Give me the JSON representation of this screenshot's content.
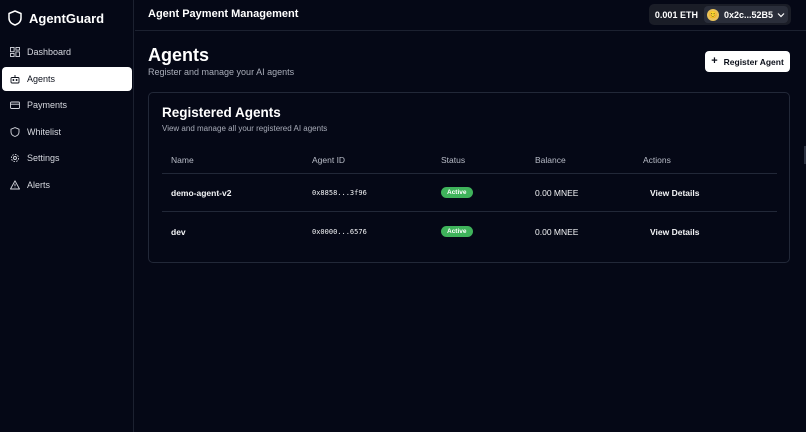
{
  "brand": {
    "name": "AgentGuard",
    "icon": "shield-icon"
  },
  "sidebar": {
    "items": [
      {
        "label": "Dashboard",
        "icon": "grid-icon",
        "active": false
      },
      {
        "label": "Agents",
        "icon": "robot-icon",
        "active": true
      },
      {
        "label": "Payments",
        "icon": "credit-card-icon",
        "active": false
      },
      {
        "label": "Whitelist",
        "icon": "shield-icon",
        "active": false
      },
      {
        "label": "Settings",
        "icon": "gear-icon",
        "active": false
      },
      {
        "label": "Alerts",
        "icon": "alert-triangle-icon",
        "active": false
      }
    ]
  },
  "header": {
    "title": "Agent Payment Management",
    "wallet": {
      "balance": "0.001 ETH",
      "address": "0x2c...52B5"
    }
  },
  "page": {
    "title": "Agents",
    "subtitle": "Register and manage your AI agents",
    "register_label": "Register Agent"
  },
  "card": {
    "title": "Registered Agents",
    "subtitle": "View and manage all your registered AI agents",
    "columns": [
      "Name",
      "Agent ID",
      "Status",
      "Balance",
      "Actions"
    ],
    "rows": [
      {
        "name": "demo-agent-v2",
        "id": "0x8858...3f96",
        "status": "Active",
        "balance": "0.00 MNEE",
        "action": "View Details"
      },
      {
        "name": "dev",
        "id": "0x0000...6576",
        "status": "Active",
        "balance": "0.00 MNEE",
        "action": "View Details"
      }
    ]
  },
  "colors": {
    "background": "#050816",
    "active_badge": "#3fb35b",
    "accent": "#ffffff"
  }
}
